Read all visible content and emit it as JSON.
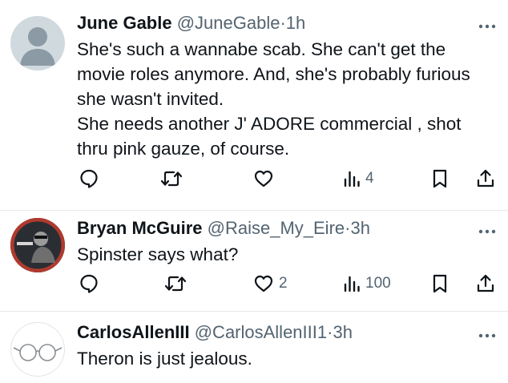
{
  "posts": [
    {
      "name": "June Gable",
      "handle": "@JuneGable",
      "separator": "·",
      "time": "1h",
      "lines": [
        "She's such a wannabe scab.  She can't get the movie roles anymore.  And, she's probably furious she wasn't invited.",
        "She needs another J' ADORE commercial , shot thru pink gauze, of course."
      ],
      "counts": {
        "replies": "",
        "reposts": "",
        "likes": "",
        "views": "4"
      }
    },
    {
      "name": "Bryan McGuire",
      "handle": "@Raise_My_Eire",
      "separator": "·",
      "time": "3h",
      "lines": [
        "Spinster says what?"
      ],
      "counts": {
        "replies": "",
        "reposts": "",
        "likes": "2",
        "views": "100"
      }
    },
    {
      "name": "CarlosAllenIII",
      "handle": "@CarlosAllenIII1",
      "separator": "·",
      "time": "3h",
      "lines": [
        "Theron is just jealous."
      ]
    }
  ],
  "icons": {
    "reply": "reply-icon",
    "repost": "repost-icon",
    "like": "like-icon",
    "views": "views-icon",
    "bookmark": "bookmark-icon",
    "share": "share-icon",
    "more": "more-icon"
  },
  "colors": {
    "text": "#0f1419",
    "secondary": "#536471",
    "divider": "#e7e9ea",
    "avatar_placeholder": "#cfd9de"
  }
}
